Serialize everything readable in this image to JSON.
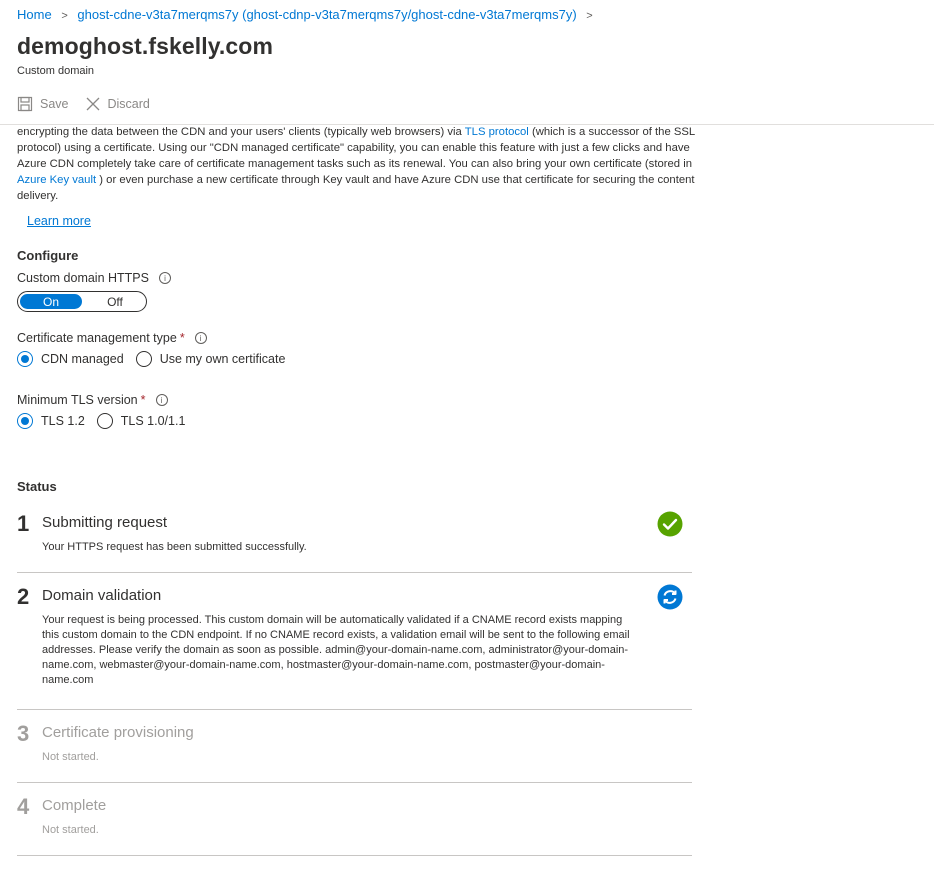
{
  "breadcrumb": {
    "home": "Home",
    "item": "ghost-cdne-v3ta7merqms7y (ghost-cdnp-v3ta7merqms7y/ghost-cdne-v3ta7merqms7y)"
  },
  "page": {
    "title": "demoghost.fskelly.com",
    "subtitle": "Custom domain"
  },
  "toolbar": {
    "save_label": "Save",
    "discard_label": "Discard"
  },
  "description": {
    "part1": "encrypting the data between the CDN and your users' clients (typically web browsers) via ",
    "link1": "TLS protocol",
    "part2": " (which is a successor of the SSL protocol) using a certificate. Using our \"CDN managed certificate\" capability, you can enable this feature with just a few clicks and have Azure CDN completely take care of certificate management tasks such as its renewal. You can also bring your own certificate (stored in ",
    "link2": "Azure Key vault",
    "part3": " ) or even purchase a new certificate through Key vault and have Azure CDN use that certificate for securing the content delivery."
  },
  "learn_more": "Learn more",
  "configure": {
    "heading": "Configure",
    "https_label": "Custom domain HTTPS",
    "toggle_on": "On",
    "toggle_off": "Off",
    "cert_label": "Certificate management type",
    "cert_options": [
      "CDN managed",
      "Use my own certificate"
    ],
    "tls_label": "Minimum TLS version",
    "tls_options": [
      "TLS 1.2",
      "TLS 1.0/1.1"
    ],
    "required_mark": "*",
    "info_glyph": "i"
  },
  "status": {
    "heading": "Status",
    "steps": [
      {
        "num": "1",
        "title": "Submitting request",
        "desc": "Your HTTPS request has been submitted successfully.",
        "state": "complete"
      },
      {
        "num": "2",
        "title": "Domain validation",
        "desc": "Your request is being processed. This custom domain will be automatically validated if a CNAME record exists mapping this custom domain to the CDN endpoint. If no CNAME record exists, a validation email will be sent to the following email addresses. Please verify the domain as soon as possible. admin@your-domain-name.com, administrator@your-domain-name.com, webmaster@your-domain-name.com, hostmaster@your-domain-name.com, postmaster@your-domain-name.com",
        "state": "in-progress"
      },
      {
        "num": "3",
        "title": "Certificate provisioning",
        "desc": "Not started.",
        "state": "not-started"
      },
      {
        "num": "4",
        "title": "Complete",
        "desc": "Not started.",
        "state": "not-started"
      }
    ]
  },
  "colors": {
    "accent": "#0078d4",
    "success": "#57a300",
    "required": "#a4262c",
    "muted": "#a19f9d"
  },
  "icons": {
    "save": "save-icon",
    "discard": "close-icon",
    "step1": "checkmark-circle-icon",
    "step2": "sync-icon"
  }
}
